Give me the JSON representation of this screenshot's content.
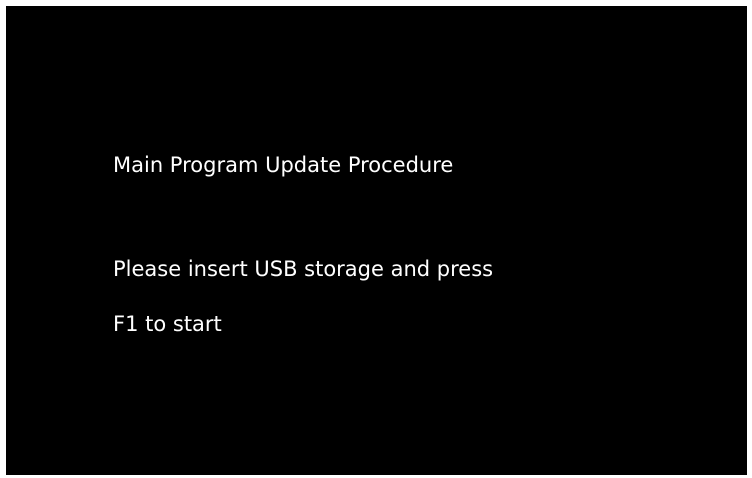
{
  "screen": {
    "title": "Main Program Update Procedure",
    "message_line_1": "Please insert USB storage and press",
    "message_line_2": "F1 to start"
  }
}
